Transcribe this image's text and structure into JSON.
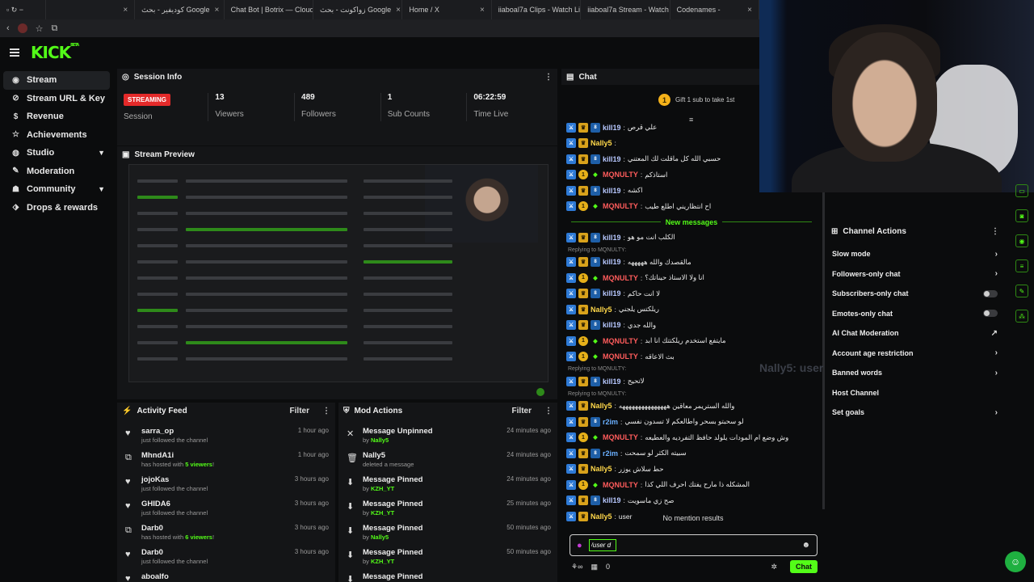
{
  "browser": {
    "tabs": [
      {
        "label": ""
      },
      {
        "label": "كوديفير - بحث Google"
      },
      {
        "label": "Chat Bot | Botrix — Cloud St"
      },
      {
        "label": "زواكونت - بحث Google"
      },
      {
        "label": "Home / X"
      },
      {
        "label": "iiaboal7a Clips - Watch Live"
      },
      {
        "label": "iiaboal7a Stream - Watch Liv"
      },
      {
        "label": "Codenames -"
      }
    ]
  },
  "app": {
    "logo": "KICK",
    "logo_sup": "BETA"
  },
  "sidebar": {
    "items": [
      {
        "label": "Stream",
        "icon": "broadcast-icon"
      },
      {
        "label": "Stream URL & Key",
        "icon": "link-icon"
      },
      {
        "label": "Revenue",
        "icon": "dollar-icon"
      },
      {
        "label": "Achievements",
        "icon": "star-icon"
      },
      {
        "label": "Studio",
        "icon": "palette-icon"
      },
      {
        "label": "Moderation",
        "icon": "wrench-icon"
      },
      {
        "label": "Community",
        "icon": "people-icon"
      },
      {
        "label": "Drops & rewards",
        "icon": "drop-icon"
      }
    ]
  },
  "session": {
    "title": "Session Info",
    "badge": "STREAMING",
    "badge_label": "Session",
    "stats": [
      {
        "value": "13",
        "label": "Viewers"
      },
      {
        "value": "489",
        "label": "Followers"
      },
      {
        "value": "1",
        "label": "Sub Counts"
      },
      {
        "value": "06:22:59",
        "label": "Time Live"
      }
    ]
  },
  "preview": {
    "title": "Stream Preview"
  },
  "activity": {
    "title": "Activity Feed",
    "filter": "Filter",
    "rows": [
      {
        "icon": "heart-icon",
        "user": "sarra_op",
        "sub": "just followed the channel",
        "time": "1 hour ago"
      },
      {
        "icon": "host-icon",
        "user": "MhndA1i",
        "sub_pre": "has hosted with ",
        "sub_hl": "5 viewers",
        "sub_post": "!",
        "time": "1 hour ago"
      },
      {
        "icon": "heart-icon",
        "user": "jojoKas",
        "sub": "just followed the channel",
        "time": "3 hours ago"
      },
      {
        "icon": "heart-icon",
        "user": "GHIDA6",
        "sub": "just followed the channel",
        "time": "3 hours ago"
      },
      {
        "icon": "host-icon",
        "user": "Darb0",
        "sub_pre": "has hosted with ",
        "sub_hl": "6 viewers",
        "sub_post": "!",
        "time": "3 hours ago"
      },
      {
        "icon": "heart-icon",
        "user": "Darb0",
        "sub": "just followed the channel",
        "time": "3 hours ago"
      },
      {
        "icon": "heart-icon",
        "user": "aboalfo",
        "sub": "",
        "time": ""
      }
    ]
  },
  "modactions": {
    "title": "Mod Actions",
    "filter": "Filter",
    "rows": [
      {
        "icon": "unpin-icon",
        "action": "Message Unpinned",
        "by": "by ",
        "mod": "Nally5",
        "time": "24 minutes ago"
      },
      {
        "icon": "trash-icon",
        "action": "Nally5",
        "by": "deleted a message",
        "mod": "",
        "time": "24 minutes ago"
      },
      {
        "icon": "pin-icon",
        "action": "Message Pinned",
        "by": "by ",
        "mod": "KZH_YT",
        "time": "24 minutes ago"
      },
      {
        "icon": "pin-icon",
        "action": "Message Pinned",
        "by": "by ",
        "mod": "KZH_YT",
        "time": "25 minutes ago"
      },
      {
        "icon": "pin-icon",
        "action": "Message Pinned",
        "by": "by ",
        "mod": "Nally5",
        "time": "50 minutes ago"
      },
      {
        "icon": "pin-icon",
        "action": "Message Pinned",
        "by": "by ",
        "mod": "KZH_YT",
        "time": "50 minutes ago"
      },
      {
        "icon": "pin-icon",
        "action": "Message Pinned",
        "by": "",
        "mod": "",
        "time": ""
      }
    ]
  },
  "chat": {
    "title": "Chat",
    "gift_text": "Gift 1 sub to take 1st",
    "gift_badge": "1",
    "new_messages": "New messages",
    "no_mention": "No mention results",
    "input_value": "/user d",
    "viewer_count": "0",
    "send_label": "Chat",
    "messages": [
      {
        "user": "kill19",
        "cls": "u-kill",
        "badges": [
          "b-blue",
          "b-crown",
          "b-sub"
        ],
        "text": "علي قرص"
      },
      {
        "user": "Nally5",
        "cls": "u-nally",
        "badges": [
          "b-blue",
          "b-crown"
        ],
        "text": ""
      },
      {
        "user": "kill19",
        "cls": "u-kill",
        "badges": [
          "b-blue",
          "b-crown",
          "b-sub"
        ],
        "text": "حسبي الله كل ماقلت لك المعتني"
      },
      {
        "user": "MQNULTY",
        "cls": "u-mq",
        "badges": [
          "b-blue",
          "b-one",
          "b-grn"
        ],
        "text": "استاذكم"
      },
      {
        "user": "kill19",
        "cls": "u-kill",
        "badges": [
          "b-blue",
          "b-crown",
          "b-sub"
        ],
        "text": "اكشه"
      },
      {
        "user": "MQNULTY",
        "cls": "u-mq",
        "badges": [
          "b-blue",
          "b-one",
          "b-grn"
        ],
        "text": "اح انتظاريني اطلع طيب"
      },
      {
        "divider": true
      },
      {
        "user": "kill19",
        "cls": "u-kill",
        "badges": [
          "b-blue",
          "b-crown",
          "b-sub"
        ],
        "text": "الكلب انت مو هو"
      },
      {
        "reply": "Replying to MQNULTY:"
      },
      {
        "user": "kill19",
        "cls": "u-kill",
        "badges": [
          "b-blue",
          "b-crown",
          "b-sub"
        ],
        "text": "مالقصدك والله هههههه"
      },
      {
        "user": "MQNULTY",
        "cls": "u-mq",
        "badges": [
          "b-blue",
          "b-one",
          "b-grn"
        ],
        "text": "انا ولا الاستاذ حيناتك؟"
      },
      {
        "user": "kill19",
        "cls": "u-kill",
        "badges": [
          "b-blue",
          "b-crown",
          "b-sub"
        ],
        "text": "لا انت حاكم"
      },
      {
        "user": "Nally5",
        "cls": "u-nally",
        "badges": [
          "b-blue",
          "b-crown"
        ],
        "text": "ريلكتس يلجني"
      },
      {
        "user": "kill19",
        "cls": "u-kill",
        "badges": [
          "b-blue",
          "b-crown",
          "b-sub"
        ],
        "text": "والله جدي"
      },
      {
        "user": "MQNULTY",
        "cls": "u-mq",
        "badges": [
          "b-blue",
          "b-one",
          "b-grn"
        ],
        "text": "مايتفع استخدم ريلكتتك انا ابد"
      },
      {
        "user": "MQNULTY",
        "cls": "u-mq",
        "badges": [
          "b-blue",
          "b-one",
          "b-grn"
        ],
        "text": "بث الاعاقه"
      },
      {
        "reply": "Replying to MQNULTY:"
      },
      {
        "user": "kill19",
        "cls": "u-kill",
        "badges": [
          "b-blue",
          "b-crown",
          "b-sub"
        ],
        "text": "لاتحيح"
      },
      {
        "reply": "Replying to MQNULTY:"
      },
      {
        "user": "Nally5",
        "cls": "u-nally",
        "badges": [
          "b-blue",
          "b-crown"
        ],
        "text": "والله الستريمر معاقين هههههههههههههههه"
      },
      {
        "user": "r2im",
        "cls": "u-r2",
        "badges": [
          "b-blue",
          "b-crown",
          "b-sub"
        ],
        "text": "لو سحبتو بسحر واطالعكم لا تسدون نفسي"
      },
      {
        "user": "MQNULTY",
        "cls": "u-mq",
        "badges": [
          "b-blue",
          "b-one",
          "b-grn"
        ],
        "text": "وش وضع ام المودات يلولد حافظ التفرديه والعطيعه"
      },
      {
        "user": "r2im",
        "cls": "u-r2",
        "badges": [
          "b-blue",
          "b-crown",
          "b-sub"
        ],
        "text": "سبيته الكثر لو سمحت"
      },
      {
        "user": "Nally5",
        "cls": "u-nally",
        "badges": [
          "b-blue",
          "b-crown"
        ],
        "text": "حط سلاش يوزر"
      },
      {
        "user": "MQNULTY",
        "cls": "u-mq",
        "badges": [
          "b-blue",
          "b-one",
          "b-grn"
        ],
        "text": "المشكله ذا مارح يفتك احرف اللي كذا"
      },
      {
        "user": "kill19",
        "cls": "u-kill",
        "badges": [
          "b-blue",
          "b-crown",
          "b-sub"
        ],
        "text": "صح زي ماسويت"
      },
      {
        "user": "Nally5",
        "cls": "u-nally",
        "badges": [
          "b-blue",
          "b-crown"
        ],
        "text": "user"
      }
    ]
  },
  "actions": {
    "title": "Channel Actions",
    "items": [
      {
        "label": "Slow mode",
        "kind": "chevron"
      },
      {
        "label": "Followers-only chat",
        "kind": "chevron"
      },
      {
        "label": "Subscribers-only chat",
        "kind": "toggle"
      },
      {
        "label": "Emotes-only chat",
        "kind": "toggle"
      },
      {
        "label": "AI Chat Moderation",
        "kind": "external"
      },
      {
        "label": "Account age restriction",
        "kind": "chevron"
      },
      {
        "label": "Banned words",
        "kind": "chevron"
      },
      {
        "label": "Host Channel",
        "kind": "none"
      },
      {
        "label": "Set goals",
        "kind": "chevron"
      }
    ]
  },
  "ghost_text": "Nally5: user",
  "colors": {
    "accent": "#53fc18",
    "live": "#e42a2a",
    "panel": "#141517",
    "bg": "#0b0c0d"
  }
}
